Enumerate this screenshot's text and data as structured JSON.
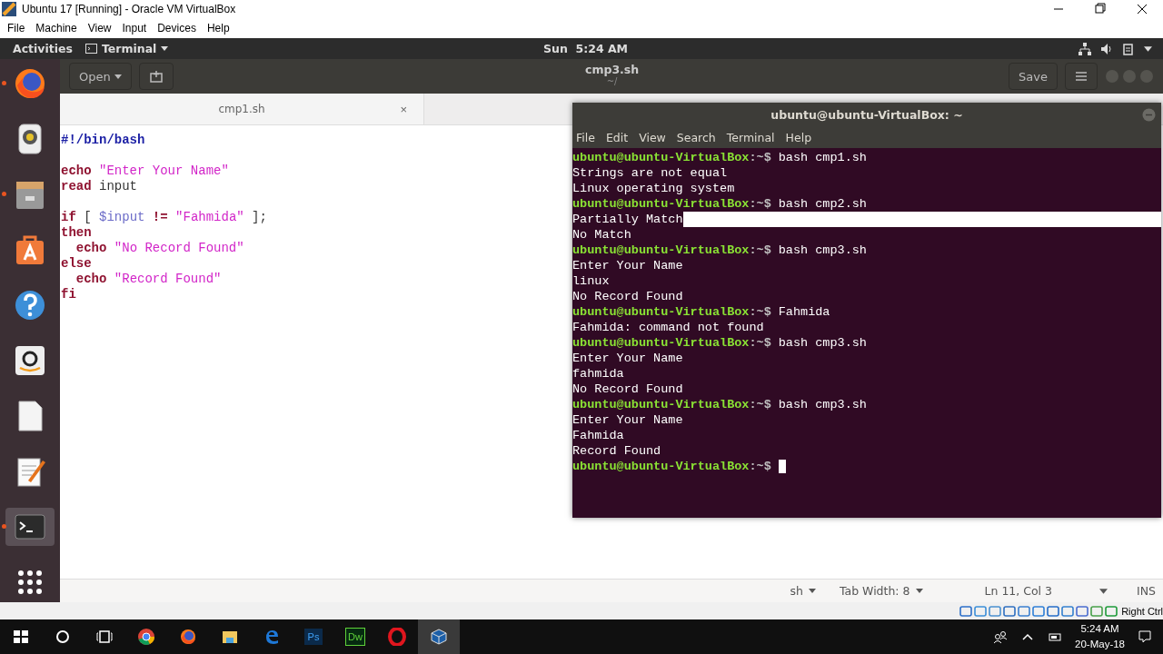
{
  "host_window": {
    "title": "Ubuntu 17 [Running] - Oracle VM VirtualBox",
    "menu": [
      "File",
      "Machine",
      "View",
      "Input",
      "Devices",
      "Help"
    ]
  },
  "top_bar": {
    "activities": "Activities",
    "app_menu": "Terminal",
    "clock": "Sun  5:24 AM"
  },
  "dock": [
    {
      "kind": "firefox",
      "running": true,
      "selected": false
    },
    {
      "kind": "speaker",
      "running": false,
      "selected": false
    },
    {
      "kind": "files",
      "running": true,
      "selected": false
    },
    {
      "kind": "software",
      "running": false,
      "selected": false
    },
    {
      "kind": "help",
      "running": false,
      "selected": false
    },
    {
      "kind": "amazon",
      "running": false,
      "selected": false
    },
    {
      "kind": "document",
      "running": false,
      "selected": false
    },
    {
      "kind": "editor",
      "running": false,
      "selected": false
    },
    {
      "kind": "terminal",
      "running": true,
      "selected": true
    },
    {
      "kind": "grid",
      "running": false,
      "selected": false
    }
  ],
  "editor": {
    "open_button": "Open",
    "title": "cmp3.sh",
    "subtitle": "~/",
    "save_button": "Save",
    "tabs": [
      {
        "label": "cmp1.sh",
        "close": "×",
        "selected": true
      }
    ],
    "code": [
      {
        "kind": "line",
        "tokens": [
          {
            "text": "#!/bin/bash",
            "kind": "shebang"
          }
        ]
      },
      {
        "kind": "blank"
      },
      {
        "kind": "line",
        "tokens": [
          {
            "text": "echo",
            "kind": "keyword"
          },
          {
            "text": " \"Enter Your Name\"",
            "kind": "string"
          }
        ]
      },
      {
        "kind": "line",
        "tokens": [
          {
            "text": "read",
            "kind": "keyword"
          },
          {
            "text": " input",
            "kind": "plain"
          }
        ]
      },
      {
        "kind": "blank"
      },
      {
        "kind": "line",
        "tokens": [
          {
            "text": "if",
            "kind": "keyword"
          },
          {
            "text": " [ ",
            "kind": "plain"
          },
          {
            "text": "$input",
            "kind": "variable"
          },
          {
            "text": " !=",
            "kind": "keyword"
          },
          {
            "text": " \"Fahmida\"",
            "kind": "string"
          },
          {
            "text": " ];",
            "kind": "plain"
          }
        ]
      },
      {
        "kind": "line",
        "tokens": [
          {
            "text": "then",
            "kind": "keyword"
          }
        ]
      },
      {
        "kind": "line",
        "tokens": [
          {
            "text": "  echo",
            "kind": "keyword"
          },
          {
            "text": " \"No Record Found\"",
            "kind": "string"
          }
        ]
      },
      {
        "kind": "line",
        "tokens": [
          {
            "text": "else",
            "kind": "keyword"
          }
        ]
      },
      {
        "kind": "line",
        "tokens": [
          {
            "text": "  echo",
            "kind": "keyword"
          },
          {
            "text": " \"Record Found\"",
            "kind": "string"
          }
        ]
      },
      {
        "kind": "line",
        "tokens": [
          {
            "text": "fi",
            "kind": "keyword"
          }
        ]
      }
    ],
    "status": {
      "language": "sh",
      "tab_width": "Tab Width: 8",
      "position": "Ln 11, Col 3",
      "mode": "INS"
    }
  },
  "terminal": {
    "title": "ubuntu@ubuntu-VirtualBox: ~",
    "menu": [
      "File",
      "Edit",
      "View",
      "Search",
      "Terminal",
      "Help"
    ],
    "lines": [
      {
        "kind": "prompt",
        "user": "ubuntu@ubuntu-VirtualBox",
        "path": ":~$",
        "command": "bash cmp1.sh"
      },
      {
        "kind": "output",
        "text": "Strings are not equal",
        "highlighted": false
      },
      {
        "kind": "output",
        "text": "Linux operating system",
        "highlighted": false
      },
      {
        "kind": "prompt",
        "user": "ubuntu@ubuntu-VirtualBox",
        "path": ":~$",
        "command": "bash cmp2.sh"
      },
      {
        "kind": "output",
        "text": "Partially Match",
        "highlighted": true
      },
      {
        "kind": "output",
        "text": "No Match",
        "highlighted": false
      },
      {
        "kind": "prompt",
        "user": "ubuntu@ubuntu-VirtualBox",
        "path": ":~$",
        "command": "bash cmp3.sh"
      },
      {
        "kind": "output",
        "text": "Enter Your Name",
        "highlighted": false
      },
      {
        "kind": "output",
        "text": "linux",
        "highlighted": false
      },
      {
        "kind": "output",
        "text": "No Record Found",
        "highlighted": false
      },
      {
        "kind": "prompt",
        "user": "ubuntu@ubuntu-VirtualBox",
        "path": ":~$",
        "command": "Fahmida"
      },
      {
        "kind": "output",
        "text": "Fahmida: command not found",
        "highlighted": false
      },
      {
        "kind": "prompt",
        "user": "ubuntu@ubuntu-VirtualBox",
        "path": ":~$",
        "command": "bash cmp3.sh"
      },
      {
        "kind": "output",
        "text": "Enter Your Name",
        "highlighted": false
      },
      {
        "kind": "output",
        "text": "fahmida",
        "highlighted": false
      },
      {
        "kind": "output",
        "text": "No Record Found",
        "highlighted": false
      },
      {
        "kind": "prompt",
        "user": "ubuntu@ubuntu-VirtualBox",
        "path": ":~$",
        "command": "bash cmp3.sh"
      },
      {
        "kind": "output",
        "text": "Enter Your Name",
        "highlighted": false
      },
      {
        "kind": "output",
        "text": "Fahmida",
        "highlighted": false
      },
      {
        "kind": "output",
        "text": "Record Found",
        "highlighted": false
      },
      {
        "kind": "prompt",
        "user": "ubuntu@ubuntu-VirtualBox",
        "path": ":~$",
        "cursor": true
      }
    ]
  },
  "vbox_status": {
    "host_key": "Right Ctrl"
  },
  "taskbar": {
    "apps": [
      {
        "kind": "chrome",
        "selected": false
      },
      {
        "kind": "firefox",
        "selected": false
      },
      {
        "kind": "explorer",
        "selected": false
      },
      {
        "kind": "edge",
        "selected": false
      },
      {
        "kind": "ps",
        "label": "Ps",
        "selected": false
      },
      {
        "kind": "dw",
        "label": "Dw",
        "selected": false
      },
      {
        "kind": "opera",
        "selected": false
      },
      {
        "kind": "virtualbox",
        "selected": true
      }
    ],
    "time": "5:24 AM",
    "date": "20-May-18"
  }
}
